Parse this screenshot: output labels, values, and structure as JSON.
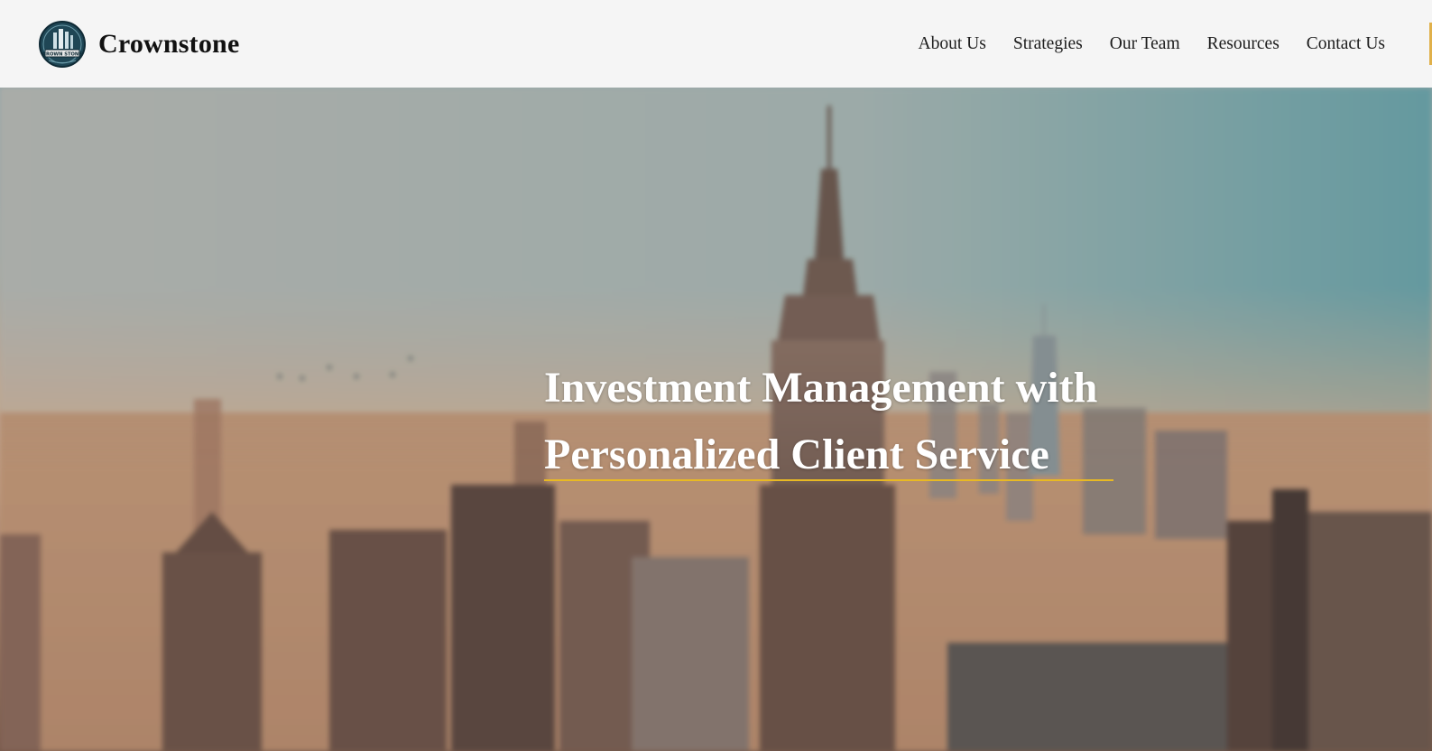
{
  "brand": {
    "name": "Crownstone",
    "logo_text": "CROWN STONE",
    "logo_icon": "crownstone-logo"
  },
  "nav": {
    "items": [
      "About Us",
      "Strategies",
      "Our Team",
      "Resources",
      "Contact Us"
    ]
  },
  "hero": {
    "title_line1": "Investment Management with",
    "title_line2": "Personalized Client Service",
    "accent_color": "#e8b923",
    "background": "blurred city skyline"
  },
  "colors": {
    "header_bg": "#f5f5f5",
    "header_accent": "#e0b04a",
    "underline": "#e8b923"
  }
}
